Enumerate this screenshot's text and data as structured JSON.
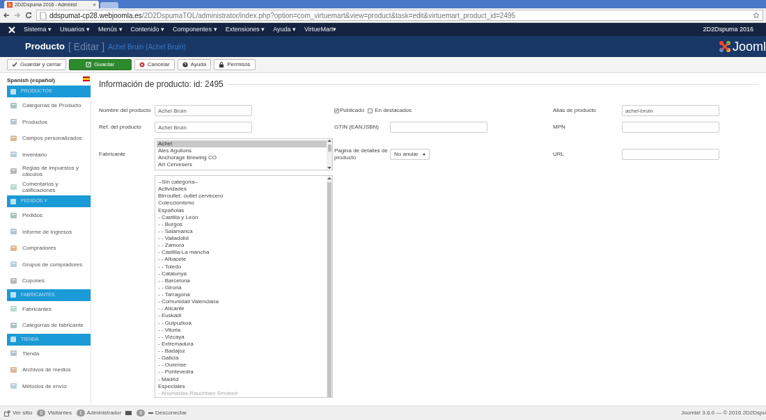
{
  "browser": {
    "tab_title": "2D2Dspuma 2016 - Administ",
    "tab_close": "×",
    "url_host": "ddspumat-cp28.webjoomla.es",
    "url_path": "/2D2DspumaTOL/administrator/index.php?option=com_virtuemart&view=product&task=edit&virtuemart_product_id=2495"
  },
  "menu": {
    "items": [
      "Sistema ▾",
      "Usuarios ▾",
      "Menús ▾",
      "Contenido ▾",
      "Componentes ▾",
      "Extensiones ▾",
      "Ayuda ▾",
      "VirtueMart▾"
    ],
    "site_link": "2D2Dspuma 2016"
  },
  "header": {
    "title": "Producto",
    "action": "[ Editar ]",
    "subtitle": "Achel Bruin (Achel Bruin)",
    "logo_text": "Jooml"
  },
  "toolbar": [
    {
      "label": "Guardar y cerrar",
      "kind": "check",
      "primary": false
    },
    {
      "label": "Guardar",
      "kind": "edit",
      "primary": true
    },
    {
      "label": "Cancelar",
      "kind": "cancel",
      "primary": false
    },
    {
      "label": "Ayuda",
      "kind": "help",
      "primary": false
    },
    {
      "label": "Permisos",
      "kind": "lock",
      "primary": false
    }
  ],
  "sidebar": {
    "language": "Spanish (español)",
    "items": [
      {
        "kind": "header",
        "label": "PRODUCTOS"
      },
      {
        "kind": "item",
        "label": "Categorías de Producto"
      },
      {
        "kind": "item",
        "label": "Productos"
      },
      {
        "kind": "item",
        "label": "Campos personalizados"
      },
      {
        "kind": "item",
        "label": "Inventario"
      },
      {
        "kind": "item",
        "label": "Reglas de impuestos y cálculos"
      },
      {
        "kind": "item",
        "label": "Comentarios y calificaciones"
      },
      {
        "kind": "header",
        "label": "PEDIDOS Y"
      },
      {
        "kind": "item",
        "label": "Pedidos"
      },
      {
        "kind": "item",
        "label": "Informe de Ingresos"
      },
      {
        "kind": "item",
        "label": "Compradores"
      },
      {
        "kind": "item",
        "label": "Grupos de compradores"
      },
      {
        "kind": "item",
        "label": "Cupones"
      },
      {
        "kind": "header",
        "label": "FABRICANTES"
      },
      {
        "kind": "item",
        "label": "Fabricantes"
      },
      {
        "kind": "item",
        "label": "Categorías de fabricante"
      },
      {
        "kind": "header",
        "label": "TIENDA"
      },
      {
        "kind": "item",
        "label": "Tienda"
      },
      {
        "kind": "item",
        "label": "Archivos de medios"
      },
      {
        "kind": "item",
        "label": "Métodos de envío"
      }
    ]
  },
  "form": {
    "heading": "Información de producto: id: 2495",
    "name": {
      "label": "Nombre del producto",
      "value": "Achel Bruin"
    },
    "sku": {
      "label": "Ref. del producto",
      "value": "Achel Bruin"
    },
    "manufacturer": {
      "label": "Fabricante",
      "options": [
        {
          "label": "Achel",
          "selected": true
        },
        {
          "label": "Ales Agullons",
          "selected": false
        },
        {
          "label": "Anchorage Brewing CO",
          "selected": false
        },
        {
          "label": "Art Cervesers",
          "selected": false
        }
      ]
    },
    "categories": [
      {
        "label": "--Sin categoría--"
      },
      {
        "label": "Actividades"
      },
      {
        "label": "Birroutlet, outlet cervecero"
      },
      {
        "label": "Coleccionismo"
      },
      {
        "label": "Españolas"
      },
      {
        "label": "- Castilla y León"
      },
      {
        "label": "- - Burgos"
      },
      {
        "label": "- - Salamanca"
      },
      {
        "label": "- - Valladolid"
      },
      {
        "label": "- - Zamora"
      },
      {
        "label": "- Castilla-La mancha"
      },
      {
        "label": "- - Albacete"
      },
      {
        "label": "- - Toledo"
      },
      {
        "label": "- Catalunya"
      },
      {
        "label": "- - Barcelona"
      },
      {
        "label": "- - Girona"
      },
      {
        "label": "- - Tarragona"
      },
      {
        "label": "- Comunidad Valenciana"
      },
      {
        "label": "- - Alicante"
      },
      {
        "label": "- Euskadi"
      },
      {
        "label": "- - Guipuzkoa"
      },
      {
        "label": "- - Vitoria"
      },
      {
        "label": "- - Vizcaya"
      },
      {
        "label": "- Extremadura"
      },
      {
        "label": "- - Badajoz"
      },
      {
        "label": "- Galicia"
      },
      {
        "label": "- - Ourense"
      },
      {
        "label": "- - Pontevedra"
      },
      {
        "label": "- Madrid"
      },
      {
        "label": "Especiales"
      },
      {
        "label": "- Ahumadas-Rauchbier-Smoked",
        "disabled": true
      }
    ],
    "published": {
      "label": "Publicado",
      "checked": true
    },
    "featured": {
      "label": "En destacados",
      "checked": false
    },
    "gtin": {
      "label": "GTIN (EAN,ISBN)"
    },
    "details_page": {
      "label": "Pagina de detalles de producto",
      "value": "No anular"
    },
    "alias": {
      "label": "Alias de producto",
      "value": "achel-bruin"
    },
    "mpn": {
      "label": "MPN"
    },
    "url": {
      "label": "URL"
    }
  },
  "status_bar": {
    "view_site": "Ver sitio",
    "visitors_count": "0",
    "visitors": "Visitantes",
    "admins_count": "1",
    "admins": "Administrador",
    "messages_count": "0",
    "logout": "Desconectar",
    "version": "Joomla! 3.6.0 — © 2016 2D2Dspu"
  }
}
